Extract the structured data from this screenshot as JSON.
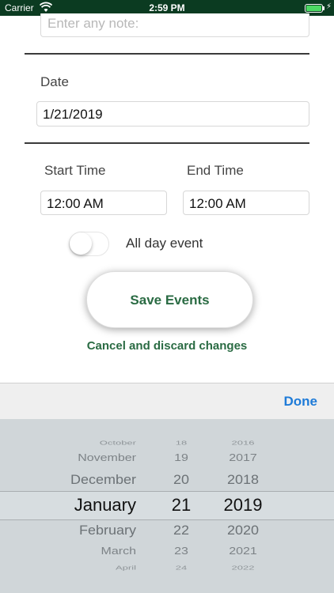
{
  "status_bar": {
    "carrier": "Carrier",
    "time": "2:59 PM"
  },
  "note": {
    "placeholder": "Enter any note:"
  },
  "date": {
    "label": "Date",
    "value": "1/21/2019"
  },
  "start_time": {
    "label": "Start Time",
    "value": "12:00 AM"
  },
  "end_time": {
    "label": "End Time",
    "value": "12:00 AM"
  },
  "all_day": {
    "label": "All day event",
    "on": false
  },
  "actions": {
    "save_label": "Save Events",
    "cancel_label": "Cancel and discard changes"
  },
  "picker": {
    "done_label": "Done",
    "selected": {
      "month": "January",
      "day": "21",
      "year": "2019"
    },
    "rows": [
      {
        "month": "October",
        "day": "18",
        "year": "2016"
      },
      {
        "month": "November",
        "day": "19",
        "year": "2017"
      },
      {
        "month": "December",
        "day": "20",
        "year": "2018"
      },
      {
        "month": "January",
        "day": "21",
        "year": "2019"
      },
      {
        "month": "February",
        "day": "22",
        "year": "2020"
      },
      {
        "month": "March",
        "day": "23",
        "year": "2021"
      },
      {
        "month": "April",
        "day": "24",
        "year": "2022"
      }
    ]
  },
  "colors": {
    "accent_green": "#2a6b43",
    "link_blue": "#1e7bd8",
    "status_bar": "#0b3b21"
  }
}
